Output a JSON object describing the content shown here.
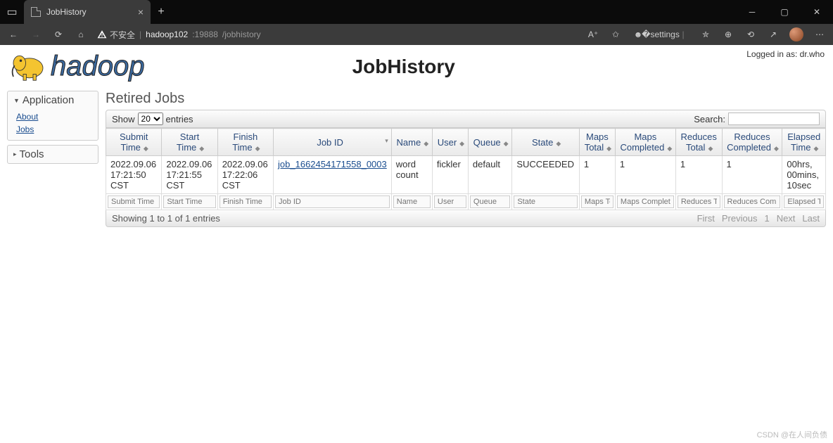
{
  "browser": {
    "tab_title": "JobHistory",
    "insecure_label": "不安全",
    "url_host": "hadoop102",
    "url_port": ":19888",
    "url_path": "/jobhistory"
  },
  "page": {
    "login_text": "Logged in as: dr.who",
    "logo_text": "hadoop",
    "title": "JobHistory"
  },
  "sidebar": {
    "app_header": "Application",
    "app_links": {
      "about": "About",
      "jobs": "Jobs"
    },
    "tools_header": "Tools"
  },
  "content": {
    "pane_title": "Retired Jobs",
    "show_label": "Show",
    "show_value": "20",
    "entries_label": "entries",
    "search_label": "Search:"
  },
  "columns": {
    "submit_time": "Submit Time",
    "start_time": "Start Time",
    "finish_time": "Finish Time",
    "job_id": "Job ID",
    "name": "Name",
    "user": "User",
    "queue": "Queue",
    "state": "State",
    "maps_total": "Maps Total",
    "maps_completed": "Maps Completed",
    "reduces_total": "Reduces Total",
    "reduces_completed": "Reduces Completed",
    "elapsed_time": "Elapsed Time"
  },
  "row": {
    "submit_time": "2022.09.06 17:21:50 CST",
    "start_time": "2022.09.06 17:21:55 CST",
    "finish_time": "2022.09.06 17:22:06 CST",
    "job_id": "job_1662454171558_0003",
    "name": "word count",
    "user": "fickler",
    "queue": "default",
    "state": "SUCCEEDED",
    "maps_total": "1",
    "maps_completed": "1",
    "reduces_total": "1",
    "reduces_completed": "1",
    "elapsed_time": "00hrs, 00mins, 10sec"
  },
  "filters": {
    "submit_time": "Submit Time",
    "start_time": "Start Time",
    "finish_time": "Finish Time",
    "job_id": "Job ID",
    "name": "Name",
    "user": "User",
    "queue": "Queue",
    "state": "State",
    "maps_total": "Maps Total",
    "maps_completed": "Maps Completed",
    "reduces_total": "Reduces Total",
    "reduces_completed": "Reduces Completed",
    "elapsed_time": "Elapsed Time"
  },
  "footer": {
    "info": "Showing 1 to 1 of 1 entries",
    "first": "First",
    "previous": "Previous",
    "page": "1",
    "next": "Next",
    "last": "Last"
  },
  "watermark": "CSDN @在人间负债"
}
